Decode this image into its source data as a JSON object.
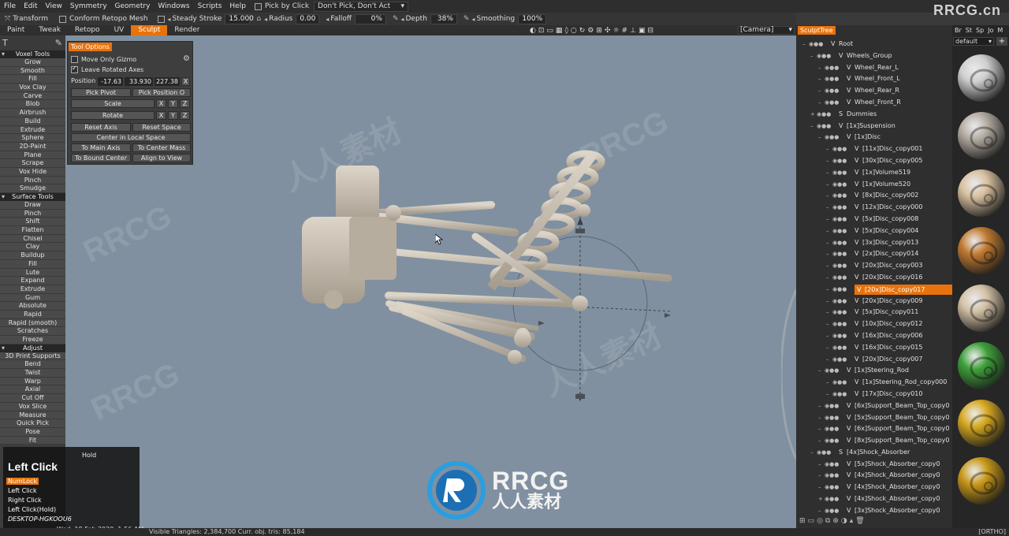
{
  "menu": [
    "File",
    "Edit",
    "View",
    "Symmetry",
    "Geometry",
    "Windows",
    "Scripts",
    "Help"
  ],
  "pick_by_click_label": "Pick by Click",
  "pick_mode_value": "Don't Pick, Don't Act",
  "brand_logo": "RRCG.cn",
  "toolbar": {
    "transform_label": "Transform",
    "conform_label": "Conform Retopo Mesh",
    "steady_label": "Steady Stroke",
    "steady_value": "15.000",
    "radius_label": "Radius",
    "radius_value": "0.00",
    "falloff_label": "Falloff",
    "falloff_value": "0%",
    "depth_label": "Depth",
    "depth_value": "38%",
    "smoothing_label": "Smoothing",
    "smoothing_value": "100%"
  },
  "rooms": [
    "Paint",
    "Tweak",
    "Retopo",
    "UV",
    "Sculpt",
    "Render"
  ],
  "active_room": "Sculpt",
  "camera_value": "[Camera]",
  "voxel_tools_header": "Voxel Tools",
  "voxel_tools": [
    "Grow",
    "Smooth",
    "Fill",
    "Vox Clay",
    "Carve",
    "Blob",
    "Airbrush",
    "Build",
    "Extrude",
    "Sphere",
    "2D-Paint",
    "Plane",
    "Scrape",
    "Vox Hide",
    "Pinch",
    "Smudge"
  ],
  "surface_tools_header": "Surface Tools",
  "surface_tools": [
    "Draw",
    "Pinch",
    "Shift",
    "Flatten",
    "Chisel",
    "Clay",
    "Buildup",
    "Fill",
    "Lute",
    "Expand",
    "Extrude",
    "Gum",
    "Absolute",
    "Rapid",
    "Rapid (smooth)",
    "Scratches",
    "Freeze"
  ],
  "adjust_header": "Adjust",
  "adjust_tools": [
    "3D Print Supports",
    "Bend",
    "Twist",
    "Warp",
    "Axial",
    "Cut Off",
    "Vox Slice",
    "Measure",
    "Quick Pick",
    "Pose",
    "Fit"
  ],
  "tool_options": {
    "title": "Tool Options",
    "move_only_gizmo": "Move Only Gizmo",
    "leave_rotated_axes": "Leave Rotated Axes",
    "position_label": "Position",
    "pos_x": "-17.63",
    "pos_y": "33.930",
    "pos_z": "227.38",
    "x_btn": "X",
    "y_btn": "Y",
    "z_btn": "Z",
    "pick_pivot": "Pick Pivot",
    "pick_position": "Pick Position O",
    "scale": "Scale",
    "rotate": "Rotate",
    "reset_axis": "Reset Axis",
    "reset_space": "Reset Space",
    "center_local": "Center in Local Space",
    "to_main_axis": "To Main Axis",
    "to_center_mass": "To Center Mass",
    "to_bound_center": "To Bound Center",
    "align_to_view": "Align to View"
  },
  "sculpt_tree_tab": "SculptTree",
  "tree": [
    {
      "prefix": "V",
      "label": "Root"
    },
    {
      "prefix": "V",
      "label": "Wheels_Group"
    },
    {
      "prefix": "V",
      "label": "Wheel_Rear_L"
    },
    {
      "prefix": "V",
      "label": "Wheel_Front_L"
    },
    {
      "prefix": "V",
      "label": "Wheel_Rear_R"
    },
    {
      "prefix": "V",
      "label": "Wheel_Front_R"
    },
    {
      "prefix": "S",
      "label": "Dummies"
    },
    {
      "prefix": "V",
      "label": "[1x]Suspension"
    },
    {
      "prefix": "V",
      "label": "[1x]Disc"
    },
    {
      "prefix": "V",
      "label": "[11x]Disc_copy001"
    },
    {
      "prefix": "V",
      "label": "[30x]Disc_copy005"
    },
    {
      "prefix": "V",
      "label": "[1x]Volume519"
    },
    {
      "prefix": "V",
      "label": "[1x]Volume520"
    },
    {
      "prefix": "V",
      "label": "[8x]Disc_copy002"
    },
    {
      "prefix": "V",
      "label": "[12x]Disc_copy000"
    },
    {
      "prefix": "V",
      "label": "[5x]Disc_copy008"
    },
    {
      "prefix": "V",
      "label": "[5x]Disc_copy004"
    },
    {
      "prefix": "V",
      "label": "[3x]Disc_copy013"
    },
    {
      "prefix": "V",
      "label": "[2x]Disc_copy014"
    },
    {
      "prefix": "V",
      "label": "[20x]Disc_copy003"
    },
    {
      "prefix": "V",
      "label": "[20x]Disc_copy016"
    },
    {
      "prefix": "V",
      "label": "[20x]Disc_copy017"
    },
    {
      "prefix": "V",
      "label": "[20x]Disc_copy009"
    },
    {
      "prefix": "V",
      "label": "[5x]Disc_copy011"
    },
    {
      "prefix": "V",
      "label": "[10x]Disc_copy012"
    },
    {
      "prefix": "V",
      "label": "[16x]Disc_copy006"
    },
    {
      "prefix": "V",
      "label": "[16x]Disc_copy015"
    },
    {
      "prefix": "V",
      "label": "[20x]Disc_copy007"
    },
    {
      "prefix": "V",
      "label": "[1x]Steering_Rod"
    },
    {
      "prefix": "V",
      "label": "[1x]Steering_Rod_copy000"
    },
    {
      "prefix": "V",
      "label": "[17x]Disc_copy010"
    },
    {
      "prefix": "V",
      "label": "[6x]Support_Beam_Top_copy0"
    },
    {
      "prefix": "V",
      "label": "[5x]Support_Beam_Top_copy0"
    },
    {
      "prefix": "V",
      "label": "[6x]Support_Beam_Top_copy0"
    },
    {
      "prefix": "V",
      "label": "[8x]Support_Beam_Top_copy0"
    },
    {
      "prefix": "S",
      "label": "[4x]Shock_Absorber"
    },
    {
      "prefix": "V",
      "label": "[5x]Shock_Absorber_copy0"
    },
    {
      "prefix": "V",
      "label": "[4x]Shock_Absorber_copy0"
    },
    {
      "prefix": "V",
      "label": "[4x]Shock_Absorber_copy0"
    },
    {
      "prefix": "V",
      "label": "[4x]Shock_Absorber_copy0"
    },
    {
      "prefix": "V",
      "label": "[3x]Shock_Absorber_copy0"
    }
  ],
  "selected_tree_label": "[20x]Disc_copy017",
  "material_tabs": [
    "Br",
    "St",
    "Sp",
    "Jo",
    "M"
  ],
  "material_dropdown": "default",
  "material_add": "+",
  "materials": [
    {
      "color": "#cfcfcf"
    },
    {
      "color": "#b4aca2"
    },
    {
      "color": "#d8c0a0"
    },
    {
      "color": "#c07a30"
    },
    {
      "color": "#d2c0a4"
    },
    {
      "color": "#3ea03a"
    },
    {
      "color": "#d6a820"
    },
    {
      "color": "#c89818"
    }
  ],
  "key_overlay": {
    "hold": "Hold",
    "big": "Left Click",
    "lines": [
      "NumLock",
      "Left Click",
      "Right Click",
      "Left Click(Hold)",
      "DESKTOP-HGKOOU6"
    ],
    "highlight": "NumLock"
  },
  "timestamp": "Wed, 19 Feb 2020, 1:56 AM",
  "status": {
    "stats": "Visible Triangles: 2,384,700   Curr. obj. tris: 85,184",
    "ortho": "[ORTHO]"
  },
  "watermark": {
    "line1": "RRCG",
    "line2": "人人素材"
  },
  "colors": {
    "accent": "#e8730c",
    "viewport": "#8090a0",
    "model": "#c9c0b2"
  }
}
